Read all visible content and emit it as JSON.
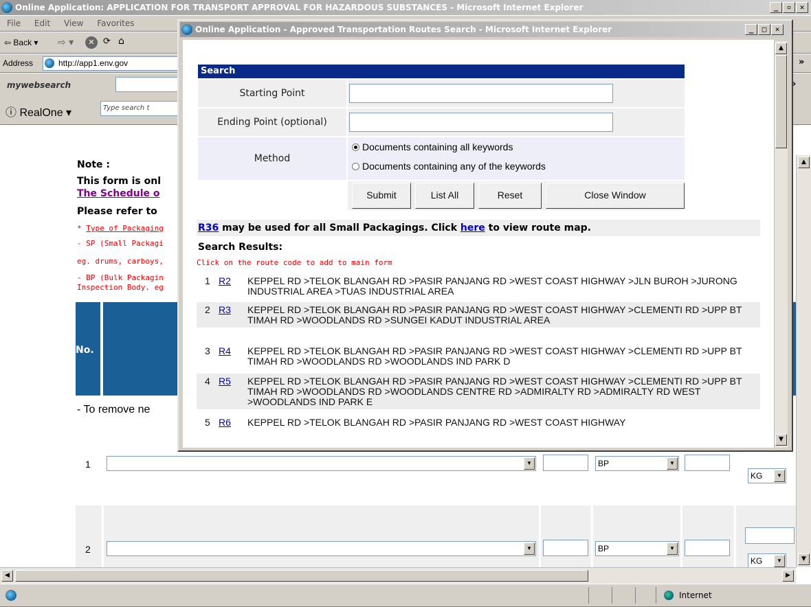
{
  "main_window": {
    "title": "Online Application: APPLICATION FOR TRANSPORT APPROVAL FOR HAZARDOUS SUBSTANCES - Microsoft Internet Explorer",
    "menu": [
      "File",
      "Edit",
      "View",
      "Favorites"
    ],
    "back_label": "Back",
    "address_label": "Address",
    "address_value": "http://app1.env.gov",
    "mywebsearch": "mywebsearch",
    "realone": "RealOne",
    "realone_placeholder": "Type search t",
    "chevron": "»"
  },
  "page": {
    "note_label": "Note :",
    "form_only": "This form is onl",
    "schedule_link": "The Schedule o",
    "please_refer": "Please refer to",
    "type_packaging": "Type of Packaging",
    "sp_line": "- SP (Small Packagi",
    "eg_line": "eg. drums, carboys,",
    "bp_line": "- BP (Bulk Packagin",
    "inspection_line": "Inspection Body. eg",
    "table_no_header": "No.",
    "remove_note": "- To remove ne",
    "rows": [
      {
        "no": "1",
        "packaging": "BP",
        "unit": "KG"
      },
      {
        "no": "2",
        "packaging": "BP",
        "unit": "KG"
      }
    ]
  },
  "status_bar": {
    "zone": "Internet"
  },
  "popup": {
    "title": "Online Application - Approved Transportation Routes Search - Microsoft Internet Explorer",
    "search_header": "Search",
    "starting_point_label": "Starting Point",
    "starting_point_value": "",
    "ending_point_label": "Ending Point (optional)",
    "ending_point_value": "",
    "method_label": "Method",
    "method_options": [
      "Documents containing all keywords",
      "Documents containing any of the keywords"
    ],
    "method_selected_index": 0,
    "buttons": {
      "submit": "Submit",
      "list_all": "List All",
      "reset": "Reset",
      "close": "Close Window"
    },
    "notice_code": "R36",
    "notice_text": " may be used for all Small Packagings. Click ",
    "notice_link": "here",
    "notice_tail": " to view route map.",
    "results_heading": "Search Results:",
    "results_hint": "Click on the route code to add to main form",
    "results": [
      {
        "no": "1",
        "code": "R2",
        "route": "KEPPEL RD >TELOK BLANGAH RD >PASIR PANJANG RD >WEST COAST HIGHWAY >JLN BUROH >JURONG INDUSTRIAL AREA >TUAS INDUSTRIAL AREA"
      },
      {
        "no": "2",
        "code": "R3",
        "route": "KEPPEL RD >TELOK BLANGAH RD >PASIR PANJANG RD >WEST COAST HIGHWAY >CLEMENTI RD >UPP BT TIMAH RD >WOODLANDS RD >SUNGEI KADUT INDUSTRIAL AREA"
      },
      {
        "no": "3",
        "code": "R4",
        "route": "KEPPEL RD >TELOK BLANGAH RD >PASIR PANJANG RD >WEST COAST HIGHWAY >CLEMENTI RD >UPP BT TIMAH RD >WOODLANDS RD >WOODLANDS IND PARK D"
      },
      {
        "no": "4",
        "code": "R5",
        "route": "KEPPEL RD >TELOK BLANGAH RD >PASIR PANJANG RD >WEST COAST HIGHWAY >CLEMENTI RD >UPP BT TIMAH RD >WOODLANDS RD >WOODLANDS CENTRE RD >ADMIRALTY RD >ADMIRALTY RD WEST >WOODLANDS IND PARK E"
      },
      {
        "no": "5",
        "code": "R6",
        "route": "KEPPEL RD >TELOK BLANGAH RD >PASIR PANJANG RD >WEST COAST HIGHWAY"
      }
    ]
  }
}
